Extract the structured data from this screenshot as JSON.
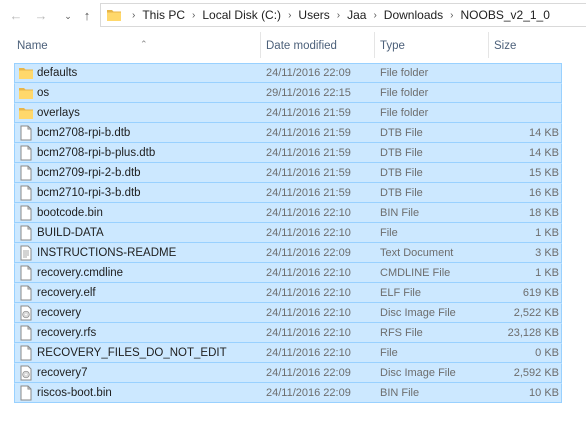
{
  "breadcrumb": [
    "This PC",
    "Local Disk (C:)",
    "Users",
    "Jaa",
    "Downloads",
    "NOOBS_v2_1_0"
  ],
  "columns": {
    "name": "Name",
    "date": "Date modified",
    "type": "Type",
    "size": "Size"
  },
  "files": [
    {
      "name": "defaults",
      "date": "24/11/2016 22:09",
      "type": "File folder",
      "size": "",
      "icon": "folder-icon"
    },
    {
      "name": "os",
      "date": "29/11/2016 22:15",
      "type": "File folder",
      "size": "",
      "icon": "folder-icon"
    },
    {
      "name": "overlays",
      "date": "24/11/2016 21:59",
      "type": "File folder",
      "size": "",
      "icon": "folder-icon"
    },
    {
      "name": "bcm2708-rpi-b.dtb",
      "date": "24/11/2016 21:59",
      "type": "DTB File",
      "size": "14 KB",
      "icon": "file-icon"
    },
    {
      "name": "bcm2708-rpi-b-plus.dtb",
      "date": "24/11/2016 21:59",
      "type": "DTB File",
      "size": "14 KB",
      "icon": "file-icon"
    },
    {
      "name": "bcm2709-rpi-2-b.dtb",
      "date": "24/11/2016 21:59",
      "type": "DTB File",
      "size": "15 KB",
      "icon": "file-icon"
    },
    {
      "name": "bcm2710-rpi-3-b.dtb",
      "date": "24/11/2016 21:59",
      "type": "DTB File",
      "size": "16 KB",
      "icon": "file-icon"
    },
    {
      "name": "bootcode.bin",
      "date": "24/11/2016 22:10",
      "type": "BIN File",
      "size": "18 KB",
      "icon": "file-icon"
    },
    {
      "name": "BUILD-DATA",
      "date": "24/11/2016 22:10",
      "type": "File",
      "size": "1 KB",
      "icon": "file-icon"
    },
    {
      "name": "INSTRUCTIONS-README",
      "date": "24/11/2016 22:09",
      "type": "Text Document",
      "size": "3 KB",
      "icon": "text-document-icon"
    },
    {
      "name": "recovery.cmdline",
      "date": "24/11/2016 22:10",
      "type": "CMDLINE File",
      "size": "1 KB",
      "icon": "file-icon"
    },
    {
      "name": "recovery.elf",
      "date": "24/11/2016 22:10",
      "type": "ELF File",
      "size": "619 KB",
      "icon": "file-icon"
    },
    {
      "name": "recovery",
      "date": "24/11/2016 22:10",
      "type": "Disc Image File",
      "size": "2,522 KB",
      "icon": "disc-image-icon"
    },
    {
      "name": "recovery.rfs",
      "date": "24/11/2016 22:10",
      "type": "RFS File",
      "size": "23,128 KB",
      "icon": "file-icon"
    },
    {
      "name": "RECOVERY_FILES_DO_NOT_EDIT",
      "date": "24/11/2016 22:10",
      "type": "File",
      "size": "0 KB",
      "icon": "file-icon"
    },
    {
      "name": "recovery7",
      "date": "24/11/2016 22:09",
      "type": "Disc Image File",
      "size": "2,592 KB",
      "icon": "disc-image-icon"
    },
    {
      "name": "riscos-boot.bin",
      "date": "24/11/2016 22:09",
      "type": "BIN File",
      "size": "10 KB",
      "icon": "file-icon"
    }
  ]
}
